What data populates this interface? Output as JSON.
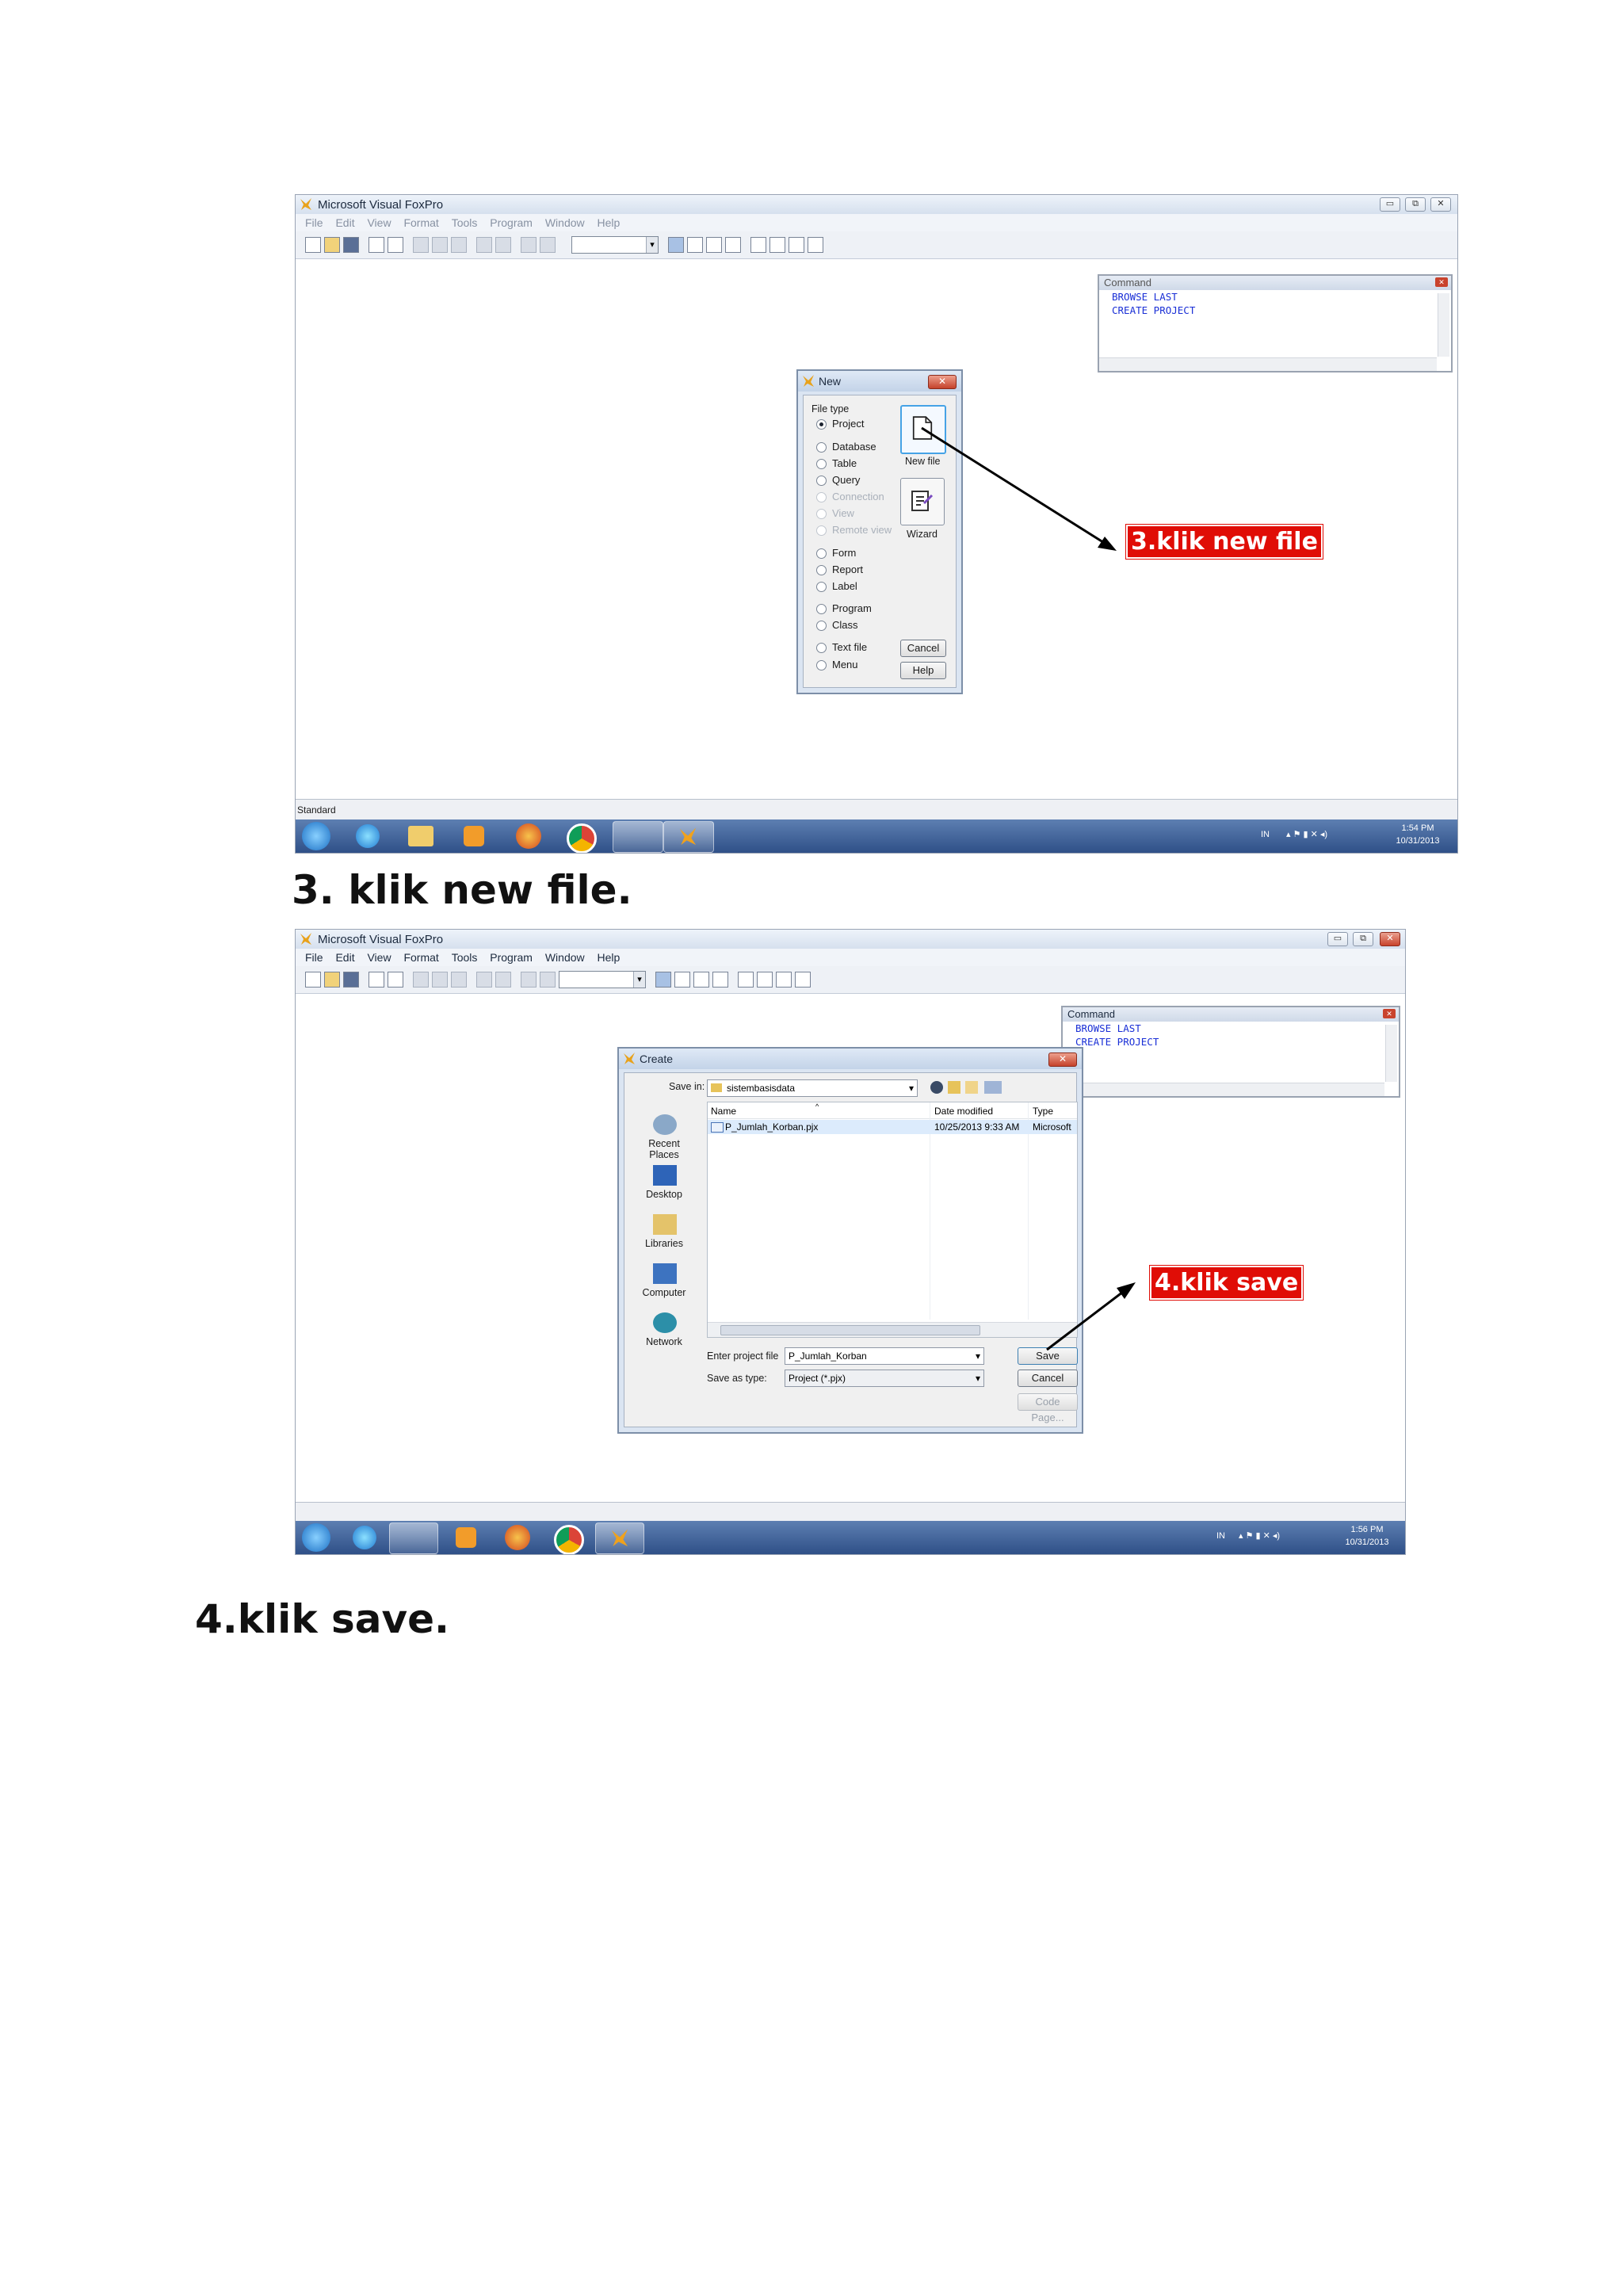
{
  "app": {
    "title": "Microsoft Visual FoxPro",
    "menus": [
      "File",
      "Edit",
      "View",
      "Format",
      "Tools",
      "Program",
      "Window",
      "Help"
    ],
    "status_label": "Standard"
  },
  "command_window": {
    "title": "Command",
    "lines": [
      "BROWSE LAST",
      "CREATE PROJECT"
    ]
  },
  "new_dialog": {
    "title": "New",
    "file_type_label": "File type",
    "options": [
      "Project",
      "Database",
      "Table",
      "Query",
      "Connection",
      "View",
      "Remote view",
      "Form",
      "Report",
      "Label",
      "Program",
      "Class",
      "Text file",
      "Menu"
    ],
    "selected": "Project",
    "new_file_label": "New file",
    "wizard_label": "Wizard",
    "cancel_label": "Cancel",
    "help_label": "Help"
  },
  "create_dialog": {
    "title": "Create",
    "save_in_label": "Save in:",
    "save_in_value": "sistembasisdata",
    "places": [
      "Recent Places",
      "Desktop",
      "Libraries",
      "Computer",
      "Network"
    ],
    "columns": [
      "Name",
      "Date modified",
      "Type"
    ],
    "rows": [
      {
        "name": "P_Jumlah_Korban.pjx",
        "date": "10/25/2013 9:33 AM",
        "type": "Microsoft"
      }
    ],
    "filename_label": "Enter project file",
    "filename_value": "P_Jumlah_Korban",
    "type_label": "Save as type:",
    "type_value": "Project (*.pjx)",
    "save_label": "Save",
    "cancel_label": "Cancel",
    "codepage_label": "Code Page..."
  },
  "tray1": {
    "lang": "IN",
    "time": "1:54 PM",
    "date": "10/31/2013"
  },
  "tray2": {
    "lang": "IN",
    "time": "1:56 PM",
    "date": "10/31/2013"
  },
  "callouts": {
    "step3": "3.klik new file",
    "step4": "4.klik save"
  },
  "captions": {
    "step3": "3. klik new file.",
    "step4": "4.klik save."
  },
  "colors": {
    "callout_red": "#e00d06",
    "command_text": "#1a2fd6",
    "taskbar": "#2f5088"
  }
}
